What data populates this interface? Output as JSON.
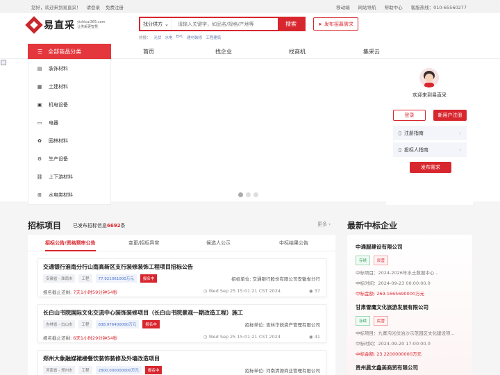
{
  "topbar": {
    "greeting": "您好，欢迎来到易直采！",
    "login": "请登录",
    "register": "免费注册",
    "links": [
      "移动端",
      "网站导航",
      "帮助中心",
      "客服热线：010-65560277"
    ]
  },
  "logo": {
    "name": "易直采",
    "domain": "yizhicai365.com",
    "slogan": "让供采更智慧"
  },
  "search": {
    "scope": "找分供方",
    "placeholder": "请输入关键字，如品名/规格/产地等",
    "button": "搜索",
    "hot_label": "热搜：",
    "hot_terms": [
      "光伏",
      "水电",
      "EPC",
      "建材装修",
      "工程建筑"
    ]
  },
  "publish_button": "发布招募需求",
  "nav": {
    "all_categories": "全部商品分类",
    "items": [
      "首页",
      "找企业",
      "找商机",
      "集采云"
    ]
  },
  "categories": [
    "装饰材料",
    "土建材料",
    "机电设备",
    "电器",
    "园林材料",
    "生产设备",
    "上下游材料",
    "水电类材料"
  ],
  "user": {
    "welcome": "欢迎来到易直采",
    "login": "登录",
    "register": "新用户注册",
    "guides": [
      "注册指南",
      "投标人指南"
    ],
    "publish_need": "发布需求"
  },
  "bidding": {
    "title": "招标项目",
    "count_prefix": "已发布招标信息",
    "count": "6692",
    "count_suffix": "条",
    "more": "更多",
    "tabs": [
      "招标公告/资格预审公告",
      "变更/招标异常",
      "候选人公示",
      "中标结果公告"
    ],
    "items": [
      {
        "title": "交通银行淮南分行山南高新区支行装修装饰工程项目招标公告",
        "region": "安徽省 - 淮南市",
        "type": "工程",
        "amount": "77.921061000万元",
        "status": "报名中",
        "unit": "招标单位: 交通银行股份有限公司安徽省分行",
        "deadline_label": "报名截止还剩: ",
        "deadline": "7天1小时59分钟54秒",
        "date": "Wed Sep 25 15:01:21 CST 2024",
        "views": "37"
      },
      {
        "title": "长白山书院国际文化交流中心装饰装修项目（长白山书院景观一期改造工程）施工",
        "region": "吉林省 - 白山市",
        "type": "工程",
        "amount": "838.976400000万元",
        "status": "报名中",
        "unit": "招标单位: 吉林华锐资产管理有限公司",
        "deadline_label": "报名截止还剩: ",
        "deadline": "6天1小时29分钟54秒",
        "date": "Wed Sep 25 15:01:21 CST 2024",
        "views": "41"
      },
      {
        "title": "郑州大象融媒裙楼餐饮装饰装修及外墙改造项目",
        "region": "河南省 - 郑州市",
        "type": "工程",
        "amount": "2800.000000000万元",
        "status": "报名中",
        "unit": "招标单位: 河南清源商业管理有限公司",
        "deadline_label": "",
        "deadline": "",
        "date": "",
        "views": ""
      }
    ]
  },
  "winners": {
    "title": "最新中标企业",
    "items": [
      {
        "name": "中通服建设有限公司",
        "badges": [
          "存续",
          "民营"
        ],
        "project": "中标项目：2024-2026年水土数据中心...",
        "time": "中标时间：2024-09-23 00:00:00.0",
        "amount": "中标金额: 269.1665690000万元"
      },
      {
        "name": "甘肃雪鹰文化旅游发展有限公司",
        "badges": [
          "存续",
          "民营"
        ],
        "project": "中标项目：九寨沟光伏治沙示范园区文化建设项...",
        "time": "中标时间：2024-09-20 17:00:00.0",
        "amount": "中标金额: 23.2200000000万元"
      },
      {
        "name": "贵州晨文鑫美商贸有限公司",
        "badges": [],
        "project": "",
        "time": "",
        "amount": ""
      }
    ]
  }
}
